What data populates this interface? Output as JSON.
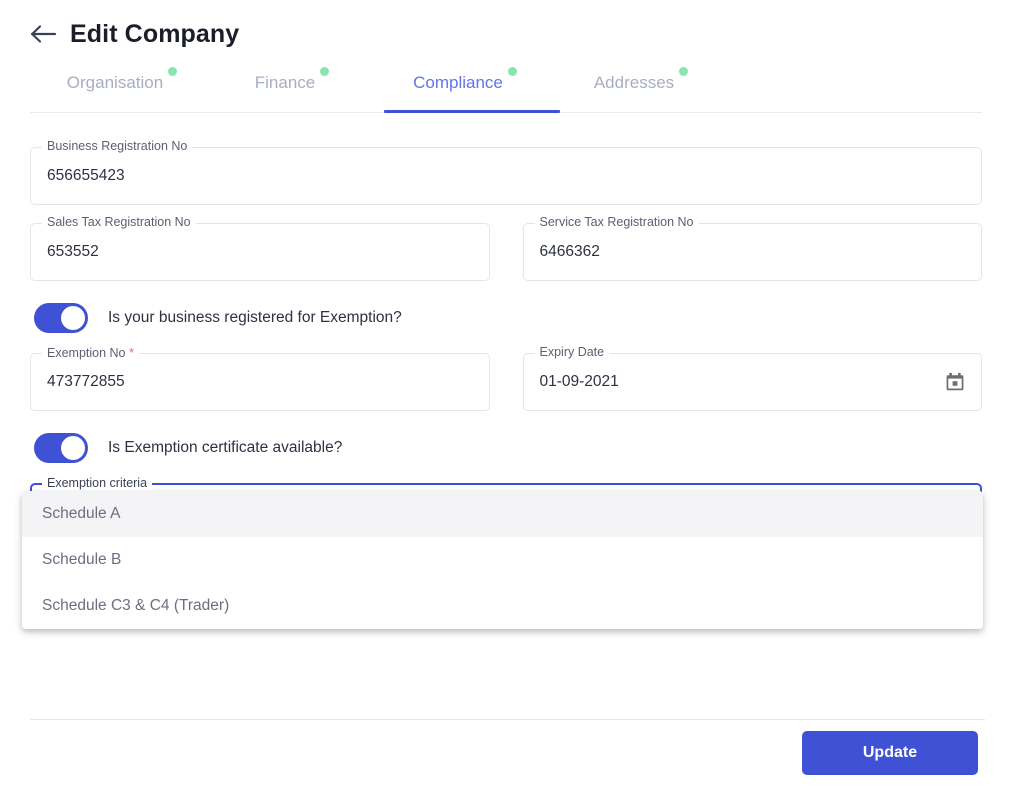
{
  "header": {
    "back_icon": "arrow-left-icon",
    "title": "Edit Company"
  },
  "tabs": [
    {
      "label": "Organisation",
      "active": false,
      "has_dot": true
    },
    {
      "label": "Finance",
      "active": false,
      "has_dot": true
    },
    {
      "label": "Compliance",
      "active": true,
      "has_dot": true
    },
    {
      "label": "Addresses",
      "active": false,
      "has_dot": true
    }
  ],
  "colors": {
    "accent": "#3f51d4",
    "tab_active": "#6174e8",
    "tab_inactive": "#a9adc4",
    "status_dot": "#86e6ad",
    "required_asterisk": "#f6645c",
    "field_border": "#e3e5ec",
    "text": "#2d3142"
  },
  "form": {
    "business_registration": {
      "label": "Business Registration No",
      "value": "656655423",
      "placeholder": ""
    },
    "sales_tax_registration": {
      "label": "Sales Tax Registration No",
      "value": "653552",
      "placeholder": ""
    },
    "service_tax_registration": {
      "label": "Service Tax Registration No",
      "value": "6466362",
      "placeholder": ""
    },
    "exemption_toggle": {
      "label": "Is your business registered for Exemption?",
      "state": "on"
    },
    "exemption_no": {
      "label": "Exemption No",
      "required_mark": "*",
      "value": "473772855",
      "placeholder": ""
    },
    "expiry_date": {
      "label": "Expiry Date",
      "value": "01-09-2021",
      "placeholder": "",
      "icon": "calendar-icon"
    },
    "certificate_toggle": {
      "label": "Is Exemption certificate available?",
      "state": "on"
    },
    "exemption_criteria": {
      "label": "Exemption criteria",
      "value": "",
      "expanded": true,
      "options": [
        {
          "label": "Schedule A",
          "highlighted": true
        },
        {
          "label": "Schedule B",
          "highlighted": false
        },
        {
          "label": "Schedule C3 & C4 (Trader)",
          "highlighted": false
        }
      ]
    }
  },
  "footer": {
    "update_label": "Update"
  }
}
